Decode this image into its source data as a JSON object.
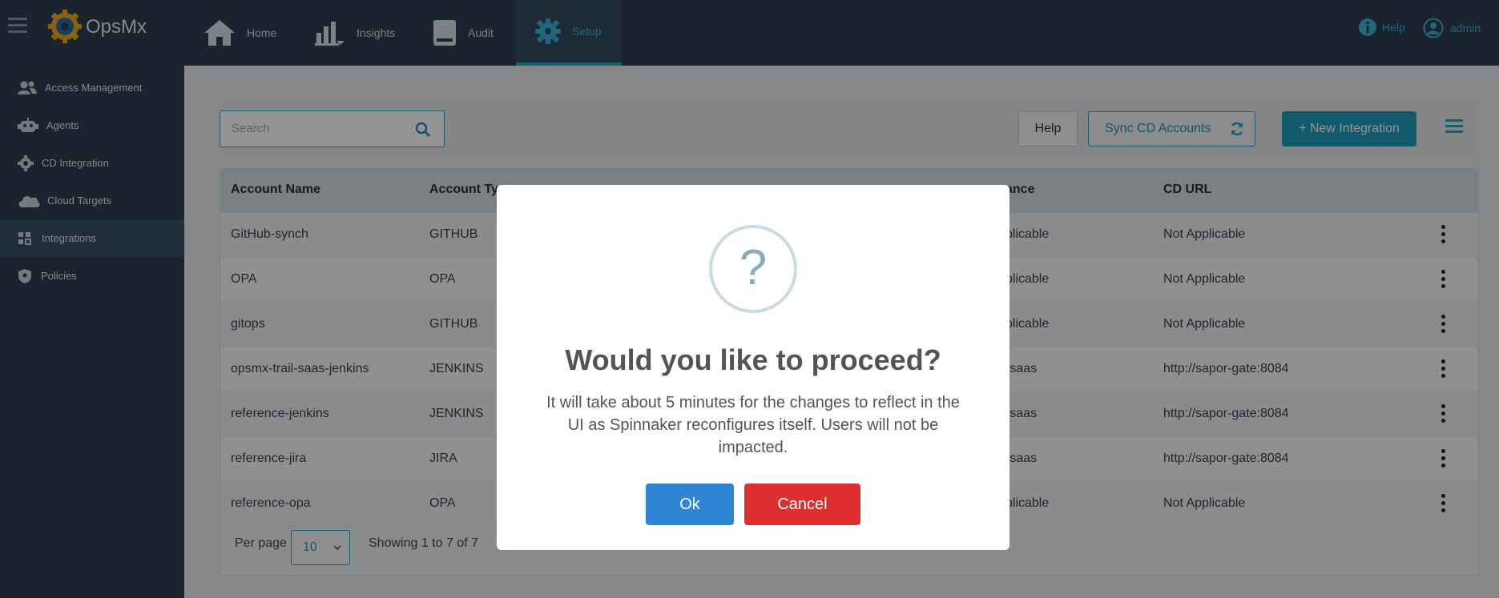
{
  "topbar": {
    "brand": "OpsMx",
    "nav": [
      {
        "label": "Home",
        "icon": "home-icon"
      },
      {
        "label": "Insights",
        "icon": "bar-chart-icon"
      },
      {
        "label": "Audit",
        "icon": "book-icon"
      },
      {
        "label": "Setup",
        "icon": "gear-icon",
        "active": true
      }
    ],
    "help_label": "Help",
    "user_label": "admin",
    "colors": {
      "bar": "#2b3e50",
      "accent": "#2aa3c6"
    }
  },
  "sidebar": {
    "items": [
      {
        "label": "Access Management",
        "icon": "users-icon"
      },
      {
        "label": "Agents",
        "icon": "robot-icon"
      },
      {
        "label": "CD Integration",
        "icon": "gear-icon"
      },
      {
        "label": "Cloud Targets",
        "icon": "cloud-icon"
      },
      {
        "label": "Integrations",
        "icon": "grid-icon",
        "active": true
      },
      {
        "label": "Policies",
        "icon": "shield-icon"
      }
    ]
  },
  "toolbar": {
    "search_placeholder": "Search",
    "help_label": "Help",
    "sync_label": "Sync CD Accounts",
    "new_label": "+ New Integration"
  },
  "table": {
    "headers": [
      "Account Name",
      "Account Type",
      "ance",
      "CD URL"
    ],
    "rows": [
      {
        "name": "GitHub-synch",
        "type": "GITHUB",
        "instance": "plicable",
        "cd_url": "Not Applicable"
      },
      {
        "name": "OPA",
        "type": "OPA",
        "instance": "plicable",
        "cd_url": "Not Applicable"
      },
      {
        "name": "gitops",
        "type": "GITHUB",
        "instance": "plicable",
        "cd_url": "Not Applicable"
      },
      {
        "name": "opsmx-trail-saas-jenkins",
        "type": "JENKINS",
        "instance": "-saas",
        "cd_url": "http://sapor-gate:8084"
      },
      {
        "name": "reference-jenkins",
        "type": "JENKINS",
        "instance": "-saas",
        "cd_url": "http://sapor-gate:8084"
      },
      {
        "name": "reference-jira",
        "type": "JIRA",
        "instance": "-saas",
        "cd_url": "http://sapor-gate:8084"
      },
      {
        "name": "reference-opa",
        "type": "OPA",
        "instance": "plicable",
        "cd_url": "Not Applicable"
      }
    ],
    "per_page_label": "Per page",
    "per_page_value": "10",
    "showing": "Showing 1 to 7 of 7"
  },
  "modal": {
    "icon_glyph": "?",
    "title": "Would you like to proceed?",
    "text": "It will take about 5 minutes for the changes to reflect in the UI as Spinnaker reconfigures itself. Users will not be impacted.",
    "ok_label": "Ok",
    "cancel_label": "Cancel",
    "colors": {
      "ok": "#2f84d4",
      "cancel": "#de2e2e"
    }
  }
}
